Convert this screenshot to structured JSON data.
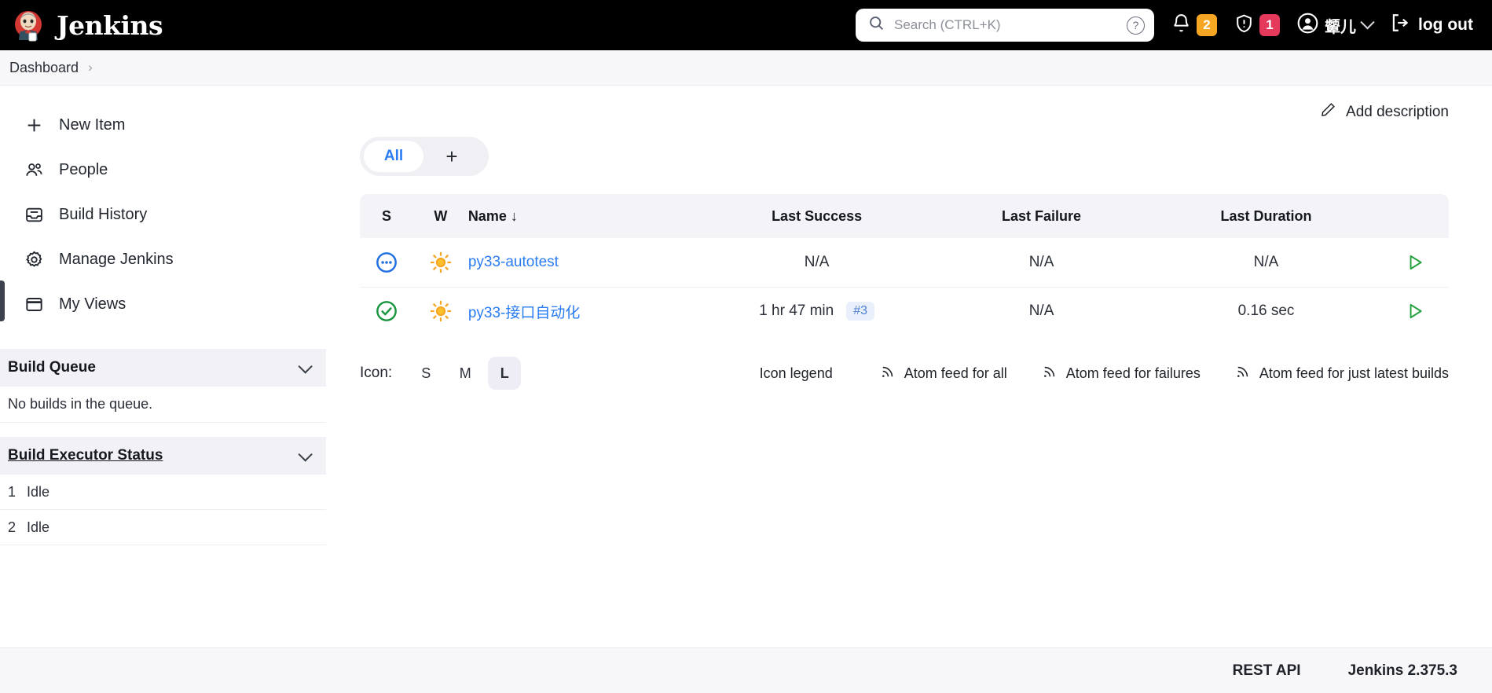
{
  "header": {
    "brand": "Jenkins",
    "logo_icon": "jenkins-butler-logo",
    "search": {
      "placeholder": "Search (CTRL+K)",
      "value": "",
      "search_icon": "search-icon",
      "help_icon": "help-circle-icon"
    },
    "notifications": {
      "icon": "bell-icon",
      "count": "2",
      "color": "#f5a623"
    },
    "security": {
      "icon": "shield-alert-icon",
      "count": "1",
      "color": "#e5395b"
    },
    "user": {
      "icon": "user-avatar-icon",
      "name": "颦儿",
      "chevron": "chevron-down-icon"
    },
    "logout": {
      "label": "log out",
      "icon": "logout-icon"
    }
  },
  "breadcrumb": {
    "items": [
      "Dashboard"
    ],
    "separator": "›"
  },
  "sidebar": {
    "items": [
      {
        "label": "New Item",
        "icon": "plus-icon",
        "active": false
      },
      {
        "label": "People",
        "icon": "people-icon",
        "active": false
      },
      {
        "label": "Build History",
        "icon": "inbox-icon",
        "active": true
      },
      {
        "label": "Manage Jenkins",
        "icon": "gear-icon",
        "active": false
      },
      {
        "label": "My Views",
        "icon": "window-icon",
        "active": false
      }
    ],
    "build_queue": {
      "title": "Build Queue",
      "chevron": "chevron-down-icon",
      "empty_text": "No builds in the queue."
    },
    "executor_status": {
      "title": "Build Executor Status",
      "chevron": "chevron-down-icon",
      "executors": [
        {
          "num": "1",
          "status": "Idle"
        },
        {
          "num": "2",
          "status": "Idle"
        }
      ]
    }
  },
  "main": {
    "add_description": {
      "label": "Add description",
      "icon": "pencil-icon"
    },
    "tabs": [
      {
        "label": "All",
        "active": true
      },
      {
        "label": "+",
        "active": false
      }
    ],
    "table": {
      "columns": [
        "S",
        "W",
        "Name",
        "Last Success",
        "Last Failure",
        "Last Duration"
      ],
      "sort_indicator": "↓",
      "sorted_column": "Name",
      "rows": [
        {
          "status_icon": "status-pending-icon",
          "status_color": "#1f6fe0",
          "weather_icon": "sunny-icon",
          "weather_color": "#f5a623",
          "name": "py33-autotest",
          "last_success": "N/A",
          "last_success_build": "",
          "last_failure": "N/A",
          "last_duration": "N/A",
          "run_icon": "run-build-icon"
        },
        {
          "status_icon": "status-success-icon",
          "status_color": "#1a9641",
          "weather_icon": "sunny-icon",
          "weather_color": "#f5a623",
          "name": "py33-接口自动化",
          "last_success": "1 hr 47 min",
          "last_success_build": "#3",
          "last_failure": "N/A",
          "last_duration": "0.16 sec",
          "run_icon": "run-build-icon"
        }
      ]
    },
    "icon_size": {
      "label": "Icon:",
      "options": [
        "S",
        "M",
        "L"
      ],
      "selected": "L"
    },
    "icon_legend": "Icon legend",
    "feeds": [
      {
        "label": "Atom feed for all",
        "icon": "rss-icon"
      },
      {
        "label": "Atom feed for failures",
        "icon": "rss-icon"
      },
      {
        "label": "Atom feed for just latest builds",
        "icon": "rss-icon"
      }
    ]
  },
  "footer": {
    "rest_api": "REST API",
    "version": "Jenkins 2.375.3"
  }
}
